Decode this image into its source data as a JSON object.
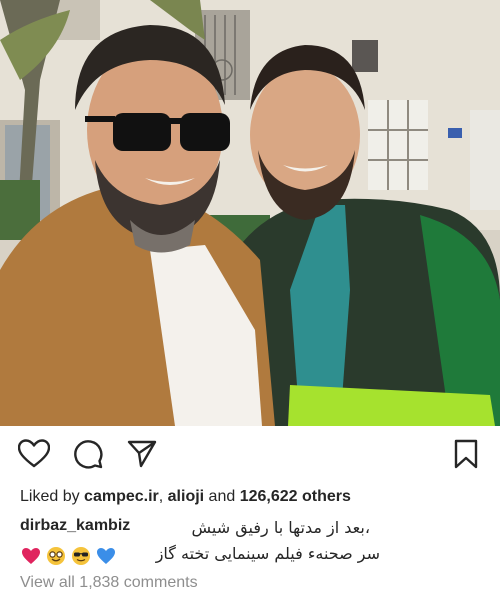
{
  "post": {
    "image_alt": "Two smiling bearded men taking a selfie outdoors in front of a building",
    "actions": {
      "like_icon": "heart-outline-icon",
      "comment_icon": "speech-bubble-icon",
      "share_icon": "paper-plane-icon",
      "save_icon": "bookmark-icon"
    },
    "likes": {
      "prefix": "Liked by ",
      "user1": "campec.ir",
      "separator": ", ",
      "user2": "alioji",
      "conjunction": " and ",
      "others": "126,622 others"
    },
    "caption": {
      "username": "dirbaz_kambiz",
      "line1": "،بعد از مدتها با رفیق شیش",
      "line2": "سر صحنهء فیلم سینمایی تخته گاز",
      "emojis": [
        "red-heart-emoji",
        "nerd-face-emoji",
        "sunglasses-face-emoji",
        "blue-heart-emoji"
      ]
    },
    "view_comments": "View all 1,838 comments"
  },
  "colors": {
    "text": "#262626",
    "muted": "#8e8e8e",
    "red_heart": "#e0245e",
    "blue_heart": "#3b8ee8",
    "emoji_yellow": "#f5c33b"
  }
}
